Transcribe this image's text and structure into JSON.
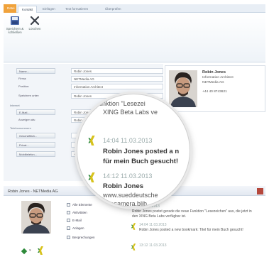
{
  "ribbon": {
    "tabs": [
      "Datei",
      "Kontakt",
      "Einfügen",
      "Text formatieren",
      "Überprüfen"
    ],
    "save_close_label": "Speichern & schließen",
    "delete_label": "Löschen"
  },
  "form": {
    "name_label": "Name...",
    "name_value": "Robin Jones",
    "company_label": "Firma:",
    "company_value": "NETMedia AG",
    "position_label": "Position:",
    "position_value": "Information Architect",
    "display_label": "Speichern unter:",
    "display_value": "Robin Jones",
    "internet_section": "Internet",
    "email_label": "E-Mail...",
    "email_value": "Robin Jones",
    "display_as_label": "Anzeigen als:",
    "display_as_value": "Robin Jones",
    "phones_section": "Telefonnummern",
    "phone1_label": "Geschäftlich...",
    "phone2_label": "Privat...",
    "phone3_label": "Mobiltelefon...",
    "phone3_value": "+49"
  },
  "card": {
    "name": "Robin Jones",
    "title": "Information Architect",
    "company": "NETMedia AG",
    "phone": "+44 40 8743621"
  },
  "people": {
    "title": "Robin Jones - NETMedia AG",
    "items": [
      "Alle Elemente",
      "Aktivitäten",
      "E-Mail",
      "Anlagen",
      "Besprechungen"
    ],
    "feed": [
      {
        "date": "19:07 10.03.2013",
        "text": "Robin Jones postet gerade die neue Funktion \"Lesezeichen\" aus, die jetzt in den XING Beta Labs verfügbar ist."
      },
      {
        "date": "14:04 11.03.2013",
        "text": "Robin Jones posted a new bookmark: Titel für mein Buch gesucht!"
      },
      {
        "date": "13:12 11.03.2013",
        "text": ""
      }
    ]
  },
  "lens": {
    "line1": "unktion \"Lesezei",
    "line2": "XING Beta Labs ve",
    "date1": "14:04 11.03.2013",
    "text1a": "Robin Jones posted a n",
    "text1b": "für mein Buch gesucht!",
    "date2": "14:12 11.03.2013",
    "name2": "Robin Jones",
    "url2": "www.sueddeutsche",
    "url3": "...rosamera.blib"
  },
  "colors": {
    "file_tab": "#f0a23b",
    "xing_green": "#2e8a3a",
    "xing_yellow": "#d7c21c"
  }
}
